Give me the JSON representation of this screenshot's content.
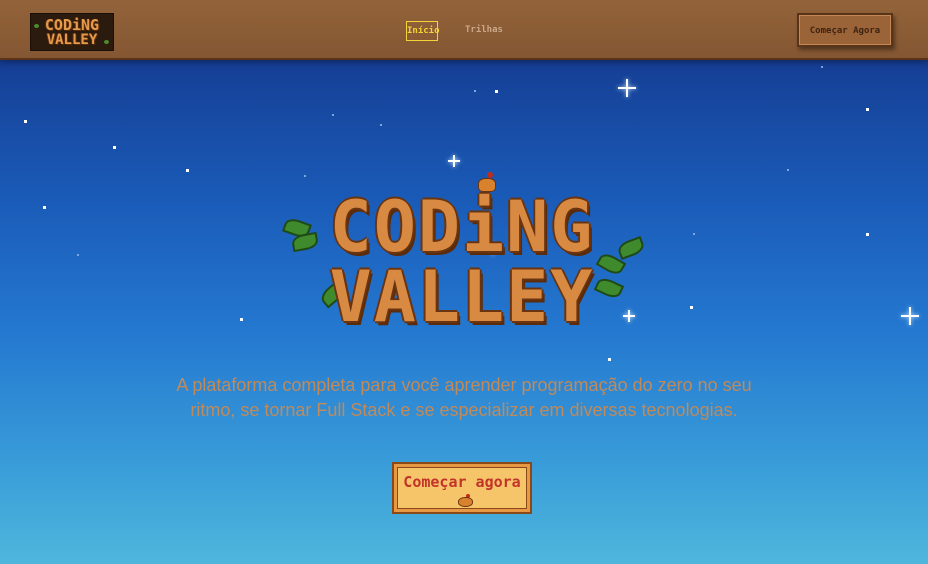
{
  "navbar": {
    "logo": {
      "line1": "CODiNG",
      "line2": "VALLEY"
    },
    "links": [
      {
        "label": "Início",
        "active": true
      },
      {
        "label": "Trilhas",
        "active": false
      }
    ],
    "cta_label": "Começar Agora"
  },
  "hero": {
    "logo": {
      "line1": "CODiNG",
      "line2": "VALLEY"
    },
    "tagline": "A plataforma completa para você aprender programação do zero no seu ritmo, se tornar Full Stack e se especializar em diversas tecnologias.",
    "cta_label": "Começar agora"
  },
  "colors": {
    "nav_bg": "#8b5b35",
    "active_link": "#f4d23a",
    "sky_top": "#13297a",
    "sky_bottom": "#4fb6dc",
    "tagline": "#c08a5a",
    "cta_bg": "#f6c56a",
    "cta_text": "#c2332a"
  },
  "icons": [
    "logo-leaf-icon",
    "chicken-icon",
    "star-icon",
    "sparkle-icon"
  ]
}
